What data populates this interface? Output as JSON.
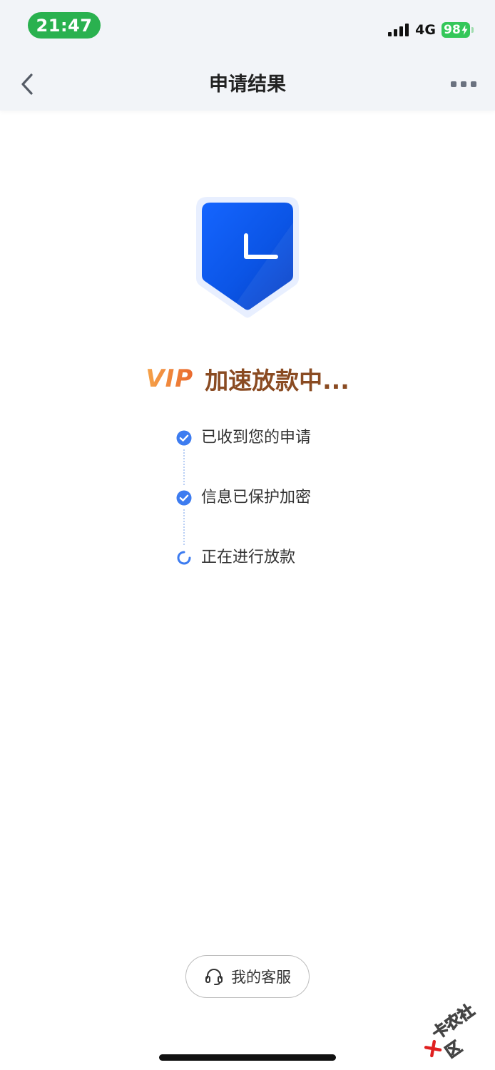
{
  "status_bar": {
    "time": "21:47",
    "network": "4G",
    "battery": "98",
    "time_pill_color": "#2ab14f",
    "battery_color": "#34c759"
  },
  "nav": {
    "title": "申请结果",
    "back_icon": "chevron-left-icon",
    "more_icon": "more-dots-icon"
  },
  "status_icon": "shield-clock-icon",
  "headline": {
    "vip": "VIP",
    "text": "加速放款中..."
  },
  "steps": [
    {
      "label": "已收到您的申请",
      "state": "done"
    },
    {
      "label": "信息已保护加密",
      "state": "done"
    },
    {
      "label": "正在进行放款",
      "state": "in-progress"
    }
  ],
  "service_button": {
    "label": "我的客服",
    "icon": "headset-icon"
  },
  "watermark": {
    "text": "卡农社区"
  },
  "colors": {
    "accent_blue": "#1f6cf2",
    "step_blue": "#3d7cf0",
    "headline_brown": "#8a4b22",
    "vip_orange": "#ef7f34"
  }
}
